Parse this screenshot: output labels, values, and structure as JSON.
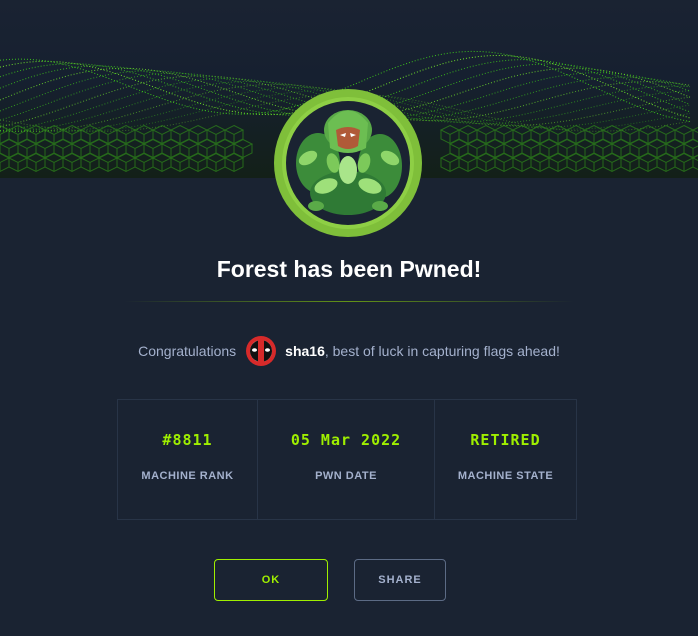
{
  "dialog": {
    "title": "Forest has been Pwned!",
    "congrats_prefix": "Congratulations",
    "username": "sha16",
    "congrats_suffix": ", best of luck in capturing flags ahead!"
  },
  "stats": [
    {
      "value": "#8811",
      "label": "MACHINE RANK"
    },
    {
      "value": "05 Mar 2022",
      "label": "PWN DATE"
    },
    {
      "value": "RETIRED",
      "label": "MACHINE STATE"
    }
  ],
  "buttons": {
    "ok": "OK",
    "share": "SHARE"
  },
  "colors": {
    "accent": "#9fef00",
    "background": "#1a2332",
    "muted_text": "#a4b1cd"
  },
  "icons": {
    "machine": "forest-machine-avatar",
    "user": "deadpool-avatar-icon"
  }
}
